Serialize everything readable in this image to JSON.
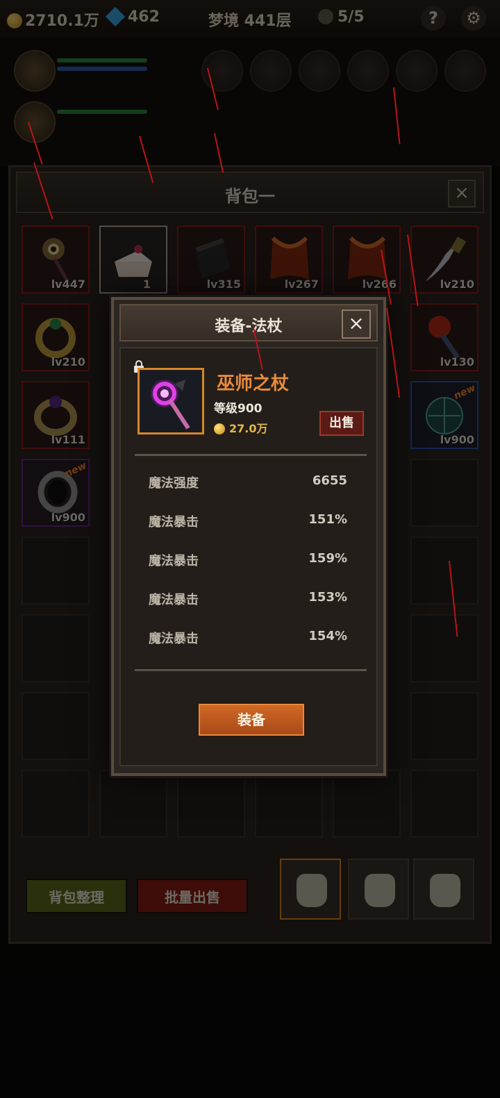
{
  "hud": {
    "gold": "2710.1万",
    "gems": "462",
    "stage": "梦境 441层",
    "keys": "5/5",
    "help_icon": "?"
  },
  "backpack": {
    "title": "背包一",
    "close_icon": "×",
    "items": [
      {
        "icon": "eye-staff-icon",
        "level": "lv447",
        "rarity": "red"
      },
      {
        "icon": "cake-icon",
        "count": "1",
        "rarity": "white"
      },
      {
        "icon": "tome-icon",
        "level": "lv315",
        "rarity": "red"
      },
      {
        "icon": "cape-icon",
        "level": "lv267",
        "rarity": "red"
      },
      {
        "icon": "cape-icon",
        "level": "lv266",
        "rarity": "red"
      },
      {
        "icon": "dagger-icon",
        "level": "lv210",
        "rarity": "red"
      },
      {
        "icon": "gold-ring-icon",
        "level": "lv210",
        "rarity": "red"
      },
      {
        "icon": "fire-torch-icon",
        "level": "lv130",
        "rarity": "red"
      },
      {
        "icon": "amethyst-ring-icon",
        "level": "lv111",
        "rarity": "red"
      },
      {
        "icon": "globe-orb-icon",
        "level": "lv900",
        "rarity": "blue",
        "new": "new"
      },
      {
        "icon": "silver-ring-icon",
        "level": "lv900",
        "rarity": "purple",
        "new": "new"
      }
    ],
    "sort_button": "背包整理",
    "batch_sell_button": "批量出售"
  },
  "modal": {
    "title": "装备-法杖",
    "close_icon": "×",
    "item_name": "巫师之杖",
    "item_level": "等级900",
    "item_price": "27.0万",
    "sell_button": "出售",
    "stats": [
      {
        "name": "魔法强度",
        "value": "6655"
      },
      {
        "name": "魔法暴击",
        "value": "151%"
      },
      {
        "name": "魔法暴击",
        "value": "159%"
      },
      {
        "name": "魔法暴击",
        "value": "153%"
      },
      {
        "name": "魔法暴击",
        "value": "154%"
      }
    ],
    "equip_button": "装备"
  },
  "colors": {
    "accent_orange": "#ea8b3c",
    "rarity_red": "#8a2020",
    "rarity_purple": "#6a2a8a",
    "rarity_blue": "#2a5aa8",
    "equip_button": "#c0581e"
  }
}
